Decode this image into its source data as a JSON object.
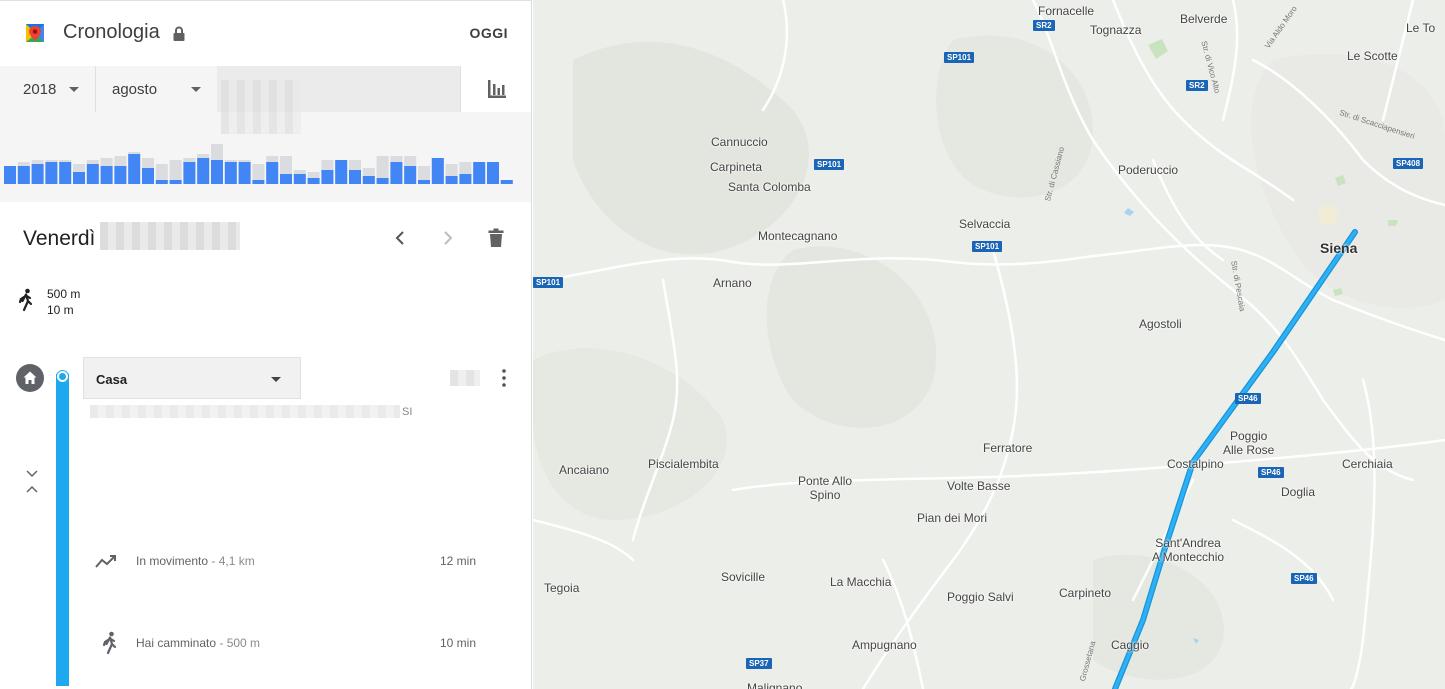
{
  "header": {
    "title": "Cronologia",
    "today": "OGGI"
  },
  "selectors": {
    "year": "2018",
    "month": "agosto"
  },
  "activity_chart": {
    "bars": [
      {
        "total": 0.45,
        "active": 0.45
      },
      {
        "total": 0.55,
        "active": 0.45
      },
      {
        "total": 0.6,
        "active": 0.5
      },
      {
        "total": 0.6,
        "active": 0.55
      },
      {
        "total": 0.6,
        "active": 0.55
      },
      {
        "total": 0.5,
        "active": 0.3
      },
      {
        "total": 0.6,
        "active": 0.5
      },
      {
        "total": 0.65,
        "active": 0.45
      },
      {
        "total": 0.7,
        "active": 0.45
      },
      {
        "total": 0.8,
        "active": 0.75
      },
      {
        "total": 0.65,
        "active": 0.4
      },
      {
        "total": 0.5,
        "active": 0.1
      },
      {
        "total": 0.6,
        "active": 0.1
      },
      {
        "total": 0.65,
        "active": 0.55
      },
      {
        "total": 0.75,
        "active": 0.65
      },
      {
        "total": 1.0,
        "active": 0.6
      },
      {
        "total": 0.6,
        "active": 0.55
      },
      {
        "total": 0.6,
        "active": 0.55
      },
      {
        "total": 0.5,
        "active": 0.1
      },
      {
        "total": 0.7,
        "active": 0.55
      },
      {
        "total": 0.7,
        "active": 0.25
      },
      {
        "total": 0.35,
        "active": 0.25
      },
      {
        "total": 0.3,
        "active": 0.15
      },
      {
        "total": 0.6,
        "active": 0.35
      },
      {
        "total": 0.6,
        "active": 0.6
      },
      {
        "total": 0.6,
        "active": 0.35
      },
      {
        "total": 0.4,
        "active": 0.2
      },
      {
        "total": 0.7,
        "active": 0.15
      },
      {
        "total": 0.7,
        "active": 0.55
      },
      {
        "total": 0.7,
        "active": 0.45
      },
      {
        "total": 0.45,
        "active": 0.1
      },
      {
        "total": 0.65,
        "active": 0.65
      },
      {
        "total": 0.5,
        "active": 0.2
      },
      {
        "total": 0.55,
        "active": 0.25
      },
      {
        "total": 0.55,
        "active": 0.55
      },
      {
        "total": 0.55,
        "active": 0.55
      },
      {
        "total": 0.1,
        "active": 0.1
      }
    ]
  },
  "day": {
    "weekday": "Venerdì"
  },
  "summary": {
    "distance": "500 m",
    "duration": "10 m"
  },
  "place": {
    "name": "Casa",
    "address_suffix": "SI"
  },
  "activities": [
    {
      "label": "In movimento",
      "detail": " - 4,1 km",
      "duration": "12 min",
      "icon": "route-icon"
    },
    {
      "label": "Hai camminato",
      "detail": " - 500 m",
      "duration": "10 min",
      "icon": "walk-icon"
    }
  ],
  "map": {
    "places": [
      {
        "name": "Fornacelle"
      },
      {
        "name": "Tognazza"
      },
      {
        "name": "Belverde"
      },
      {
        "name": "Le To"
      },
      {
        "name": "Le Scotte"
      },
      {
        "name": "Cannuccio"
      },
      {
        "name": "Carpineta"
      },
      {
        "name": "Santa Colomba"
      },
      {
        "name": "Poderuccio"
      },
      {
        "name": "Selvaccia"
      },
      {
        "name": "Montecagnano"
      },
      {
        "name": "Siena"
      },
      {
        "name": "Arnano"
      },
      {
        "name": "Agostoli"
      },
      {
        "name": "Poggio\nAlle Rose"
      },
      {
        "name": "Ferratore"
      },
      {
        "name": "Costalpino"
      },
      {
        "name": "Cerchiaia"
      },
      {
        "name": "Ancaiano"
      },
      {
        "name": "Piscialembita"
      },
      {
        "name": "Ponte Allo\nSpino"
      },
      {
        "name": "Volte Basse"
      },
      {
        "name": "Doglia"
      },
      {
        "name": "Pian dei Mori"
      },
      {
        "name": "Sant'Andrea\nA Montecchio"
      },
      {
        "name": "Tegoia"
      },
      {
        "name": "Sovicille"
      },
      {
        "name": "La Macchia"
      },
      {
        "name": "Poggio Salvi"
      },
      {
        "name": "Carpineto"
      },
      {
        "name": "Caggio"
      },
      {
        "name": "Ampugnano"
      },
      {
        "name": "Malignano"
      }
    ],
    "roads": [
      {
        "label": "SR2"
      },
      {
        "label": "SP101"
      },
      {
        "label": "SR2"
      },
      {
        "label": "SP101"
      },
      {
        "label": "SP408"
      },
      {
        "label": "SP101"
      },
      {
        "label": "SP101"
      },
      {
        "label": "SP46"
      },
      {
        "label": "SP46"
      },
      {
        "label": "SP46"
      },
      {
        "label": "SP37"
      }
    ],
    "street_names": [
      {
        "text": "Str. di Vico Alto"
      },
      {
        "text": "Via Aldo Moro"
      },
      {
        "text": "Str. di Scacciapensieri"
      },
      {
        "text": "Str. di Cassiano"
      },
      {
        "text": "Str. di Pescaia"
      },
      {
        "text": "Grossetana"
      }
    ]
  },
  "colors": {
    "accent": "#1ea8f0",
    "bar_active": "#4285f4",
    "bar_idle": "#dadce0",
    "route": "#1ea8f0"
  }
}
